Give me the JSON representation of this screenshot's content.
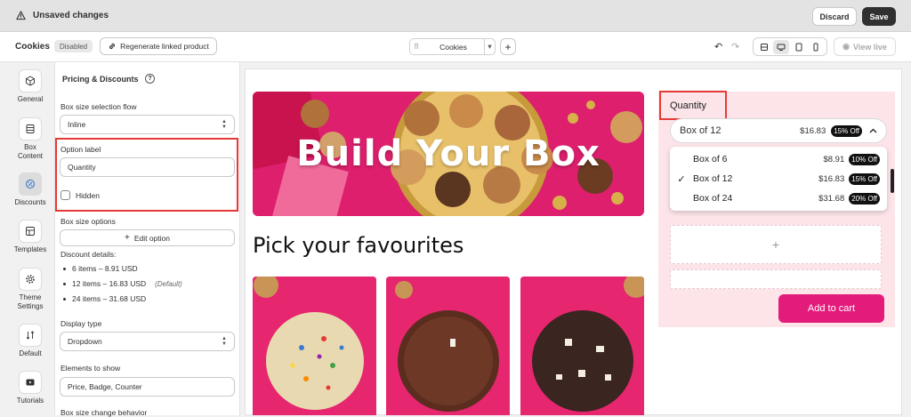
{
  "topbar": {
    "status": "Unsaved changes",
    "discard": "Discard",
    "save": "Save"
  },
  "toolbar": {
    "app_name": "Cookies",
    "status_badge": "Disabled",
    "regenerate": "Regenerate linked product",
    "template": "Cookies",
    "view_live": "View live"
  },
  "nav": [
    {
      "label": "General"
    },
    {
      "label": "Box Content"
    },
    {
      "label": "Discounts"
    },
    {
      "label": "Templates"
    },
    {
      "label": "Theme Settings"
    },
    {
      "label": "Default"
    },
    {
      "label": "Tutorials"
    }
  ],
  "panel": {
    "title": "Pricing & Discounts",
    "flow_label": "Box size selection flow",
    "flow_value": "Inline",
    "option_label": "Option label",
    "option_value": "Quantity",
    "hidden": "Hidden",
    "sizes_label": "Box size options",
    "edit_option": "Edit option",
    "discount_details": "Discount details:",
    "details": [
      {
        "text": "6 items – 8.91 USD",
        "note": ""
      },
      {
        "text": "12 items – 16.83 USD",
        "note": "(Default)"
      },
      {
        "text": "24 items – 31.68 USD",
        "note": ""
      }
    ],
    "display_label": "Display type",
    "display_value": "Dropdown",
    "elements_label": "Elements to show",
    "elements_value": "Price, Badge, Counter",
    "change_label": "Box size change behavior"
  },
  "preview": {
    "hero_title": "Build Your Box",
    "subtitle": "Pick your favourites",
    "quantity_label": "Quantity",
    "selected": {
      "name": "Box of 12",
      "price": "$16.83",
      "badge": "15% Off"
    },
    "options": [
      {
        "check": "",
        "name": "Box of 6",
        "price": "$8.91",
        "badge": "10% Off"
      },
      {
        "check": "✓",
        "name": "Box of 12",
        "price": "$16.83",
        "badge": "15% Off"
      },
      {
        "check": "",
        "name": "Box of 24",
        "price": "$31.68",
        "badge": "20% Off"
      }
    ],
    "add_to_cart": "Add to cart",
    "slot_plus": "+"
  },
  "colors": {
    "accent": "#e31b7b",
    "hero": "#dd1f6d",
    "highlight": "#e53935",
    "panel_bg": "#fce4e9"
  }
}
